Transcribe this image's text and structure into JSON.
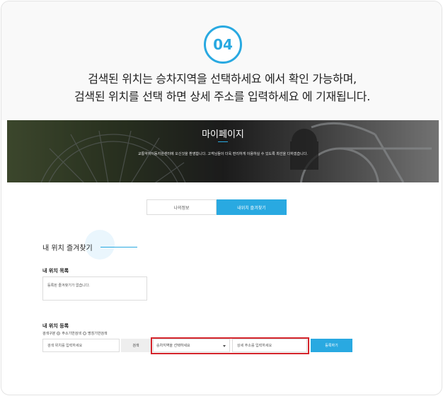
{
  "step": {
    "number": "04"
  },
  "caption": {
    "line1": "검색된 위치는 승차지역을 선택하세요 에서 확인 가능하며,",
    "line2": "검색된 위치를 선택 하면 상세 주소를 입력하세요 에 기재됩니다."
  },
  "banner": {
    "title": "마이페이지",
    "description": "교통약자이동지원센터에 오신것을 환영합니다. 고객님들이 더욱 편리하게 이용하실 수 있도록 최선을 다하겠습니다."
  },
  "tabs": [
    {
      "label": "나의정보"
    },
    {
      "label": "내위치 즐겨찾기"
    }
  ],
  "section": {
    "title": "내 위치 즐겨찾기"
  },
  "location_list": {
    "title": "내 위치 목록",
    "empty_text": "등록된 즐겨찾기가 없습니다."
  },
  "register": {
    "title": "내 위치 등록",
    "search_type_label": "검색구분",
    "options": [
      "주소기반검색",
      "명칭기반검색"
    ],
    "selected_option": "주소기반검색",
    "search_placeholder": "검색 위치를 입력하세요",
    "search_button": "검색",
    "area_select_value": "승차지역을 선택하세요",
    "detail_placeholder": "상세 주소를 입력하세요",
    "submit_button": "등록하기"
  },
  "colors": {
    "accent": "#29a9e1",
    "highlight": "#d4242b"
  }
}
